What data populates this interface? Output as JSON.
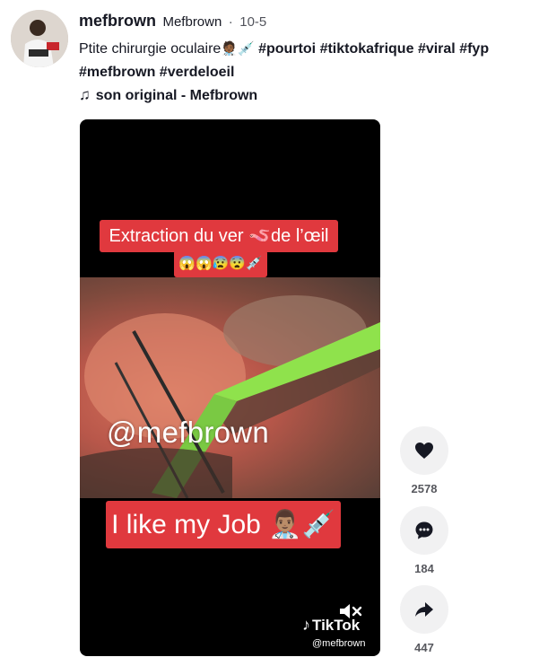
{
  "post": {
    "username": "mefbrown",
    "nickname": "Mefbrown",
    "separator": "·",
    "date": "10-5",
    "caption_text": "Ptite chirurgie oculaire",
    "caption_emojis": "🧑🏾‍⚕️💉",
    "hashtags": [
      "#pourtoi",
      "#tiktokafrique",
      "#viral",
      "#fyp",
      "#mefbrown",
      "#verdeloeil"
    ]
  },
  "music": {
    "icon": "music-note-icon",
    "glyph": "♫",
    "title": "son original - Mefbrown"
  },
  "video": {
    "overlay_top": "Extraction du ver 🪱de l’œil",
    "overlay_emojis": "😱😱😰😨💉",
    "overlay_handle": "@mefbrown",
    "overlay_bottom": "I like my Job 👨🏽‍⚕️💉",
    "watermark_brand": "TikTok",
    "watermark_handle": "@mefbrown",
    "mute_icon": "speaker-muted-icon"
  },
  "actions": {
    "like": {
      "icon": "heart-icon",
      "count": "2578"
    },
    "comment": {
      "icon": "comment-icon",
      "count": "184"
    },
    "share": {
      "icon": "share-arrow-icon",
      "count": "447"
    }
  },
  "colors": {
    "overlay_label": "#e0393e",
    "action_bg": "#f1f1f2",
    "count_text": "#57585e"
  }
}
